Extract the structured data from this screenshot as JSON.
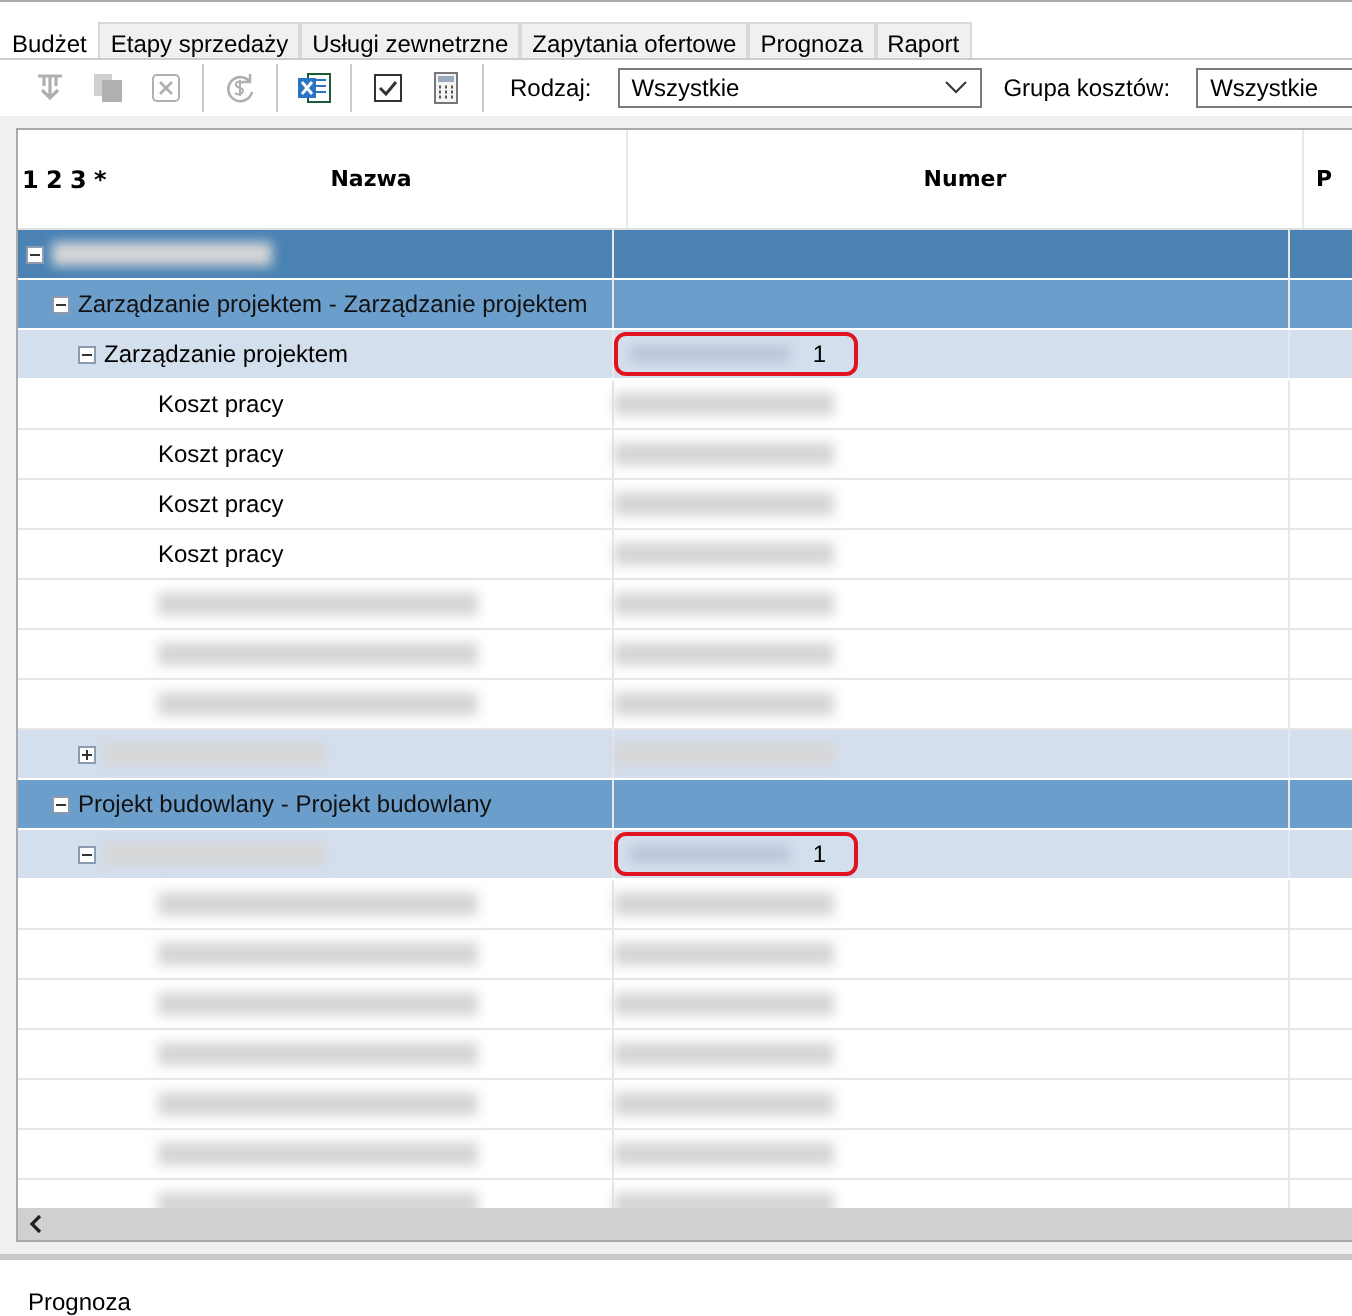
{
  "tabs": [
    {
      "label": "Budżet",
      "selected": true
    },
    {
      "label": "Etapy sprzedaży",
      "selected": false
    },
    {
      "label": "Usługi zewnetrzne",
      "selected": false
    },
    {
      "label": "Zapytania ofertowe",
      "selected": false
    },
    {
      "label": "Prognoza",
      "selected": false
    },
    {
      "label": "Raport",
      "selected": false
    }
  ],
  "toolbar": [
    {
      "kind": "import",
      "disabled": true
    },
    {
      "kind": "copy",
      "disabled": true
    },
    {
      "kind": "delete",
      "disabled": true
    },
    {
      "kind": "refresh",
      "disabled": true
    },
    {
      "kind": "excel",
      "disabled": false
    },
    {
      "kind": "check",
      "disabled": false
    },
    {
      "kind": "calc",
      "disabled": false
    }
  ],
  "filters": [
    {
      "label": "Rodzaj:",
      "value": "Wszystkie"
    },
    {
      "label": "Grupa kosztów:",
      "value": "Wszystkie"
    }
  ],
  "level_buttons": [
    "1",
    "2",
    "3",
    "*"
  ],
  "columns": [
    "Nazwa",
    "Numer",
    "P"
  ],
  "rows": [
    {
      "redacted": true,
      "expanded": true,
      "children": [
        {
          "name": "Zarządzanie projektem - Zarządzanie projektem",
          "expanded": true,
          "children": [
            {
              "name": "Zarządzanie projektem",
              "number": "1",
              "highlighted": true,
              "expanded": true,
              "children": [
                {
                  "name": "Koszt pracy"
                },
                {
                  "name": "Koszt pracy"
                },
                {
                  "name": "Koszt pracy"
                },
                {
                  "name": "Koszt pracy"
                },
                {
                  "redacted": true
                },
                {
                  "redacted": true
                },
                {
                  "redacted": true
                }
              ]
            },
            {
              "redacted": true,
              "expanded": false
            }
          ]
        },
        {
          "name": "Projekt budowlany - Projekt budowlany",
          "expanded": true,
          "children": [
            {
              "redacted": true,
              "number": "1",
              "highlighted": true,
              "expanded": true,
              "children": [
                {
                  "redacted": true
                },
                {
                  "redacted": true
                },
                {
                  "redacted": true
                },
                {
                  "redacted": true
                },
                {
                  "redacted": true
                },
                {
                  "redacted": true
                },
                {
                  "redacted": true
                }
              ]
            }
          ]
        }
      ]
    }
  ],
  "bottom_panel": {
    "title": "Prognoza"
  }
}
